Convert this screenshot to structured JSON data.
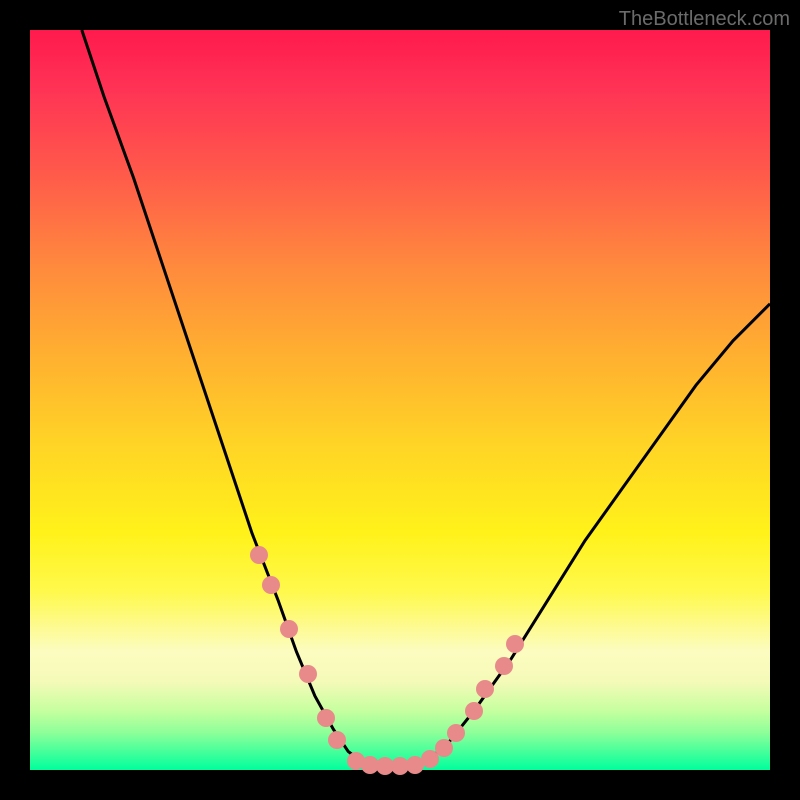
{
  "watermark": "TheBottleneck.com",
  "chart_data": {
    "type": "line",
    "title": "",
    "xlabel": "",
    "ylabel": "",
    "xlim": [
      0,
      100
    ],
    "ylim": [
      0,
      100
    ],
    "series": [
      {
        "name": "left-curve",
        "x": [
          7,
          10,
          14,
          18,
          22,
          26,
          30,
          33.5,
          36,
          38.5,
          41,
          43,
          45
        ],
        "y": [
          100,
          91,
          80,
          68,
          56,
          44,
          32,
          23,
          16,
          10,
          5.5,
          2.5,
          1
        ]
      },
      {
        "name": "valley-floor",
        "x": [
          45,
          47,
          49,
          51,
          53
        ],
        "y": [
          1,
          0.5,
          0.5,
          0.5,
          1
        ]
      },
      {
        "name": "right-curve",
        "x": [
          53,
          56,
          60,
          65,
          70,
          75,
          80,
          85,
          90,
          95,
          100
        ],
        "y": [
          1,
          3,
          8,
          15,
          23,
          31,
          38,
          45,
          52,
          58,
          63
        ]
      }
    ],
    "markers": {
      "name": "highlight-dots",
      "color": "#e88a8a",
      "points": [
        {
          "x": 31,
          "y": 29
        },
        {
          "x": 32.5,
          "y": 25
        },
        {
          "x": 35,
          "y": 19
        },
        {
          "x": 37.5,
          "y": 13
        },
        {
          "x": 40,
          "y": 7
        },
        {
          "x": 41.5,
          "y": 4
        },
        {
          "x": 44,
          "y": 1.2
        },
        {
          "x": 46,
          "y": 0.7
        },
        {
          "x": 48,
          "y": 0.5
        },
        {
          "x": 50,
          "y": 0.5
        },
        {
          "x": 52,
          "y": 0.7
        },
        {
          "x": 54,
          "y": 1.5
        },
        {
          "x": 56,
          "y": 3
        },
        {
          "x": 57.5,
          "y": 5
        },
        {
          "x": 60,
          "y": 8
        },
        {
          "x": 61.5,
          "y": 11
        },
        {
          "x": 64,
          "y": 14
        },
        {
          "x": 65.5,
          "y": 17
        }
      ]
    }
  }
}
